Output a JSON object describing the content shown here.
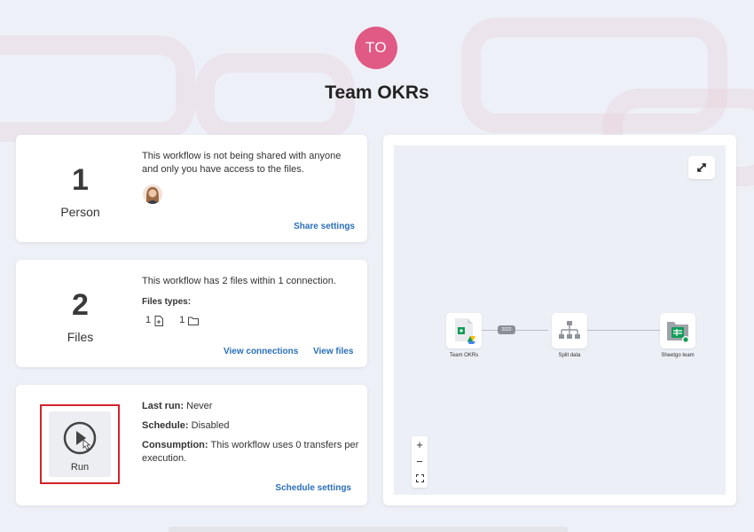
{
  "header": {
    "avatar_initials": "TO",
    "avatar_color": "#e05a85",
    "title": "Team OKRs"
  },
  "sharing_card": {
    "number": "1",
    "label": "Person",
    "description": "This workflow is not being shared with anyone and only you have access to the files.",
    "share_link": "Share settings"
  },
  "files_card": {
    "number": "2",
    "label": "Files",
    "description": "This workflow has 2 files within 1 connection.",
    "types_heading": "Files types:",
    "file_count": "1",
    "folder_count": "1",
    "connections_link": "View connections",
    "files_link": "View files"
  },
  "run_card": {
    "run_label": "Run",
    "last_run_label": "Last run:",
    "last_run_value": "Never",
    "schedule_label": "Schedule:",
    "schedule_value": "Disabled",
    "consumption_label": "Consumption:",
    "consumption_value": "This workflow uses 0 transfers per execution.",
    "schedule_link": "Schedule settings"
  },
  "diagram": {
    "expand_icon": "expand-icon",
    "nodes": [
      {
        "label": "Team OKRs",
        "icon": "google-sheets-icon"
      },
      {
        "label": "Split data",
        "icon": "split-hierarchy-icon"
      },
      {
        "label": "Sheetgo team",
        "icon": "sheets-folder-icon"
      }
    ],
    "edge_badge": "2022",
    "zoom_in": "+",
    "zoom_out": "−"
  },
  "colors": {
    "link": "#2a6fb8",
    "highlight": "#d2242a",
    "sheets_green": "#0f9d58"
  }
}
